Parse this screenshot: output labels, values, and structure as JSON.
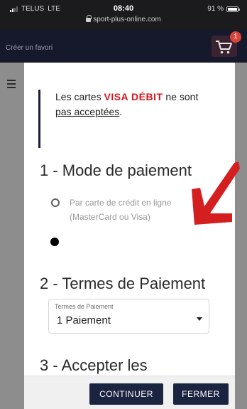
{
  "status_bar": {
    "carrier": "TELUS",
    "network": "LTE",
    "time": "08:40",
    "url": "sport-plus-online.com",
    "battery": "91 %"
  },
  "header": {
    "favorite_link": "Créer un favori",
    "cart_count": "1"
  },
  "modal": {
    "notice_prefix": "Les cartes ",
    "notice_highlight": "VISA DÉBIT",
    "notice_suffix": " ne sont",
    "notice_underlined": "pas acceptées",
    "notice_end": ".",
    "section1_title": "1 - Mode de paiement",
    "option1_label": "Par carte de crédit en ligne (MasterCard ou Visa)",
    "section2_title": "2 - Termes de Paiement",
    "terms_select": {
      "caption": "Termes de Paiement",
      "value": "1 Paiement"
    },
    "section3_title": "3 - Accepter les",
    "continue_button": "CONTINUER",
    "close_button": "FERMER"
  },
  "colors": {
    "accent_red": "#d5161c",
    "button_navy": "#1a2340",
    "header_bg": "#16182b",
    "annotation_arrow": "#d31f1f"
  },
  "icons": [
    "signal-icon",
    "lock-icon",
    "battery-icon",
    "cart-icon",
    "menu-icon",
    "arrow-annotation"
  ]
}
